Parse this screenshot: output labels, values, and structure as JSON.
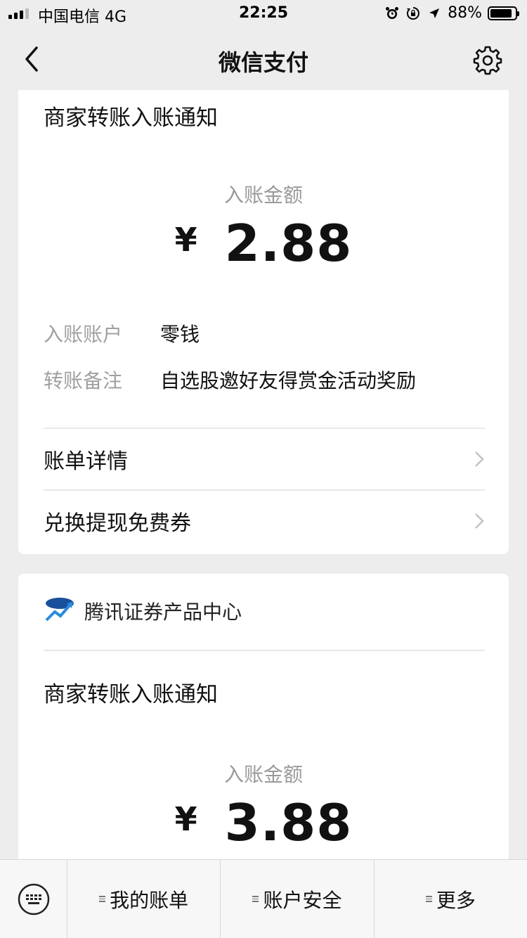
{
  "status_bar": {
    "carrier": "中国电信 4G",
    "time": "22:25",
    "battery": "88%",
    "battery_level": 0.88,
    "icons": [
      "signal-icon",
      "alarm-icon",
      "rotation-lock-icon",
      "location-icon",
      "battery-icon"
    ]
  },
  "nav": {
    "title": "微信支付",
    "back_icon": "back-chevron-icon",
    "settings_icon": "gear-icon"
  },
  "card1": {
    "header": "商家转账入账通知",
    "amount_label": "入账金额",
    "currency": "¥",
    "amount": "2.88",
    "details": [
      {
        "key": "入账账户",
        "value": "零钱"
      },
      {
        "key": "转账备注",
        "value": "自选股邀好友得赏金活动奖励"
      }
    ],
    "links": [
      {
        "label": "账单详情"
      },
      {
        "label": "兑换提现免费券"
      }
    ]
  },
  "card2": {
    "merchant_name": "腾讯证券产品中心",
    "header": "商家转账入账通知",
    "amount_label": "入账金额",
    "currency": "¥",
    "amount": "3.88"
  },
  "bottom_bar": {
    "items": [
      {
        "label": "我的账单"
      },
      {
        "label": "账户安全"
      },
      {
        "label": "更多"
      }
    ],
    "keyboard_icon": "keyboard-icon"
  },
  "colors": {
    "background": "#ededed",
    "card": "#ffffff",
    "muted_text": "#9a9a9a",
    "primary_text": "#111111"
  }
}
